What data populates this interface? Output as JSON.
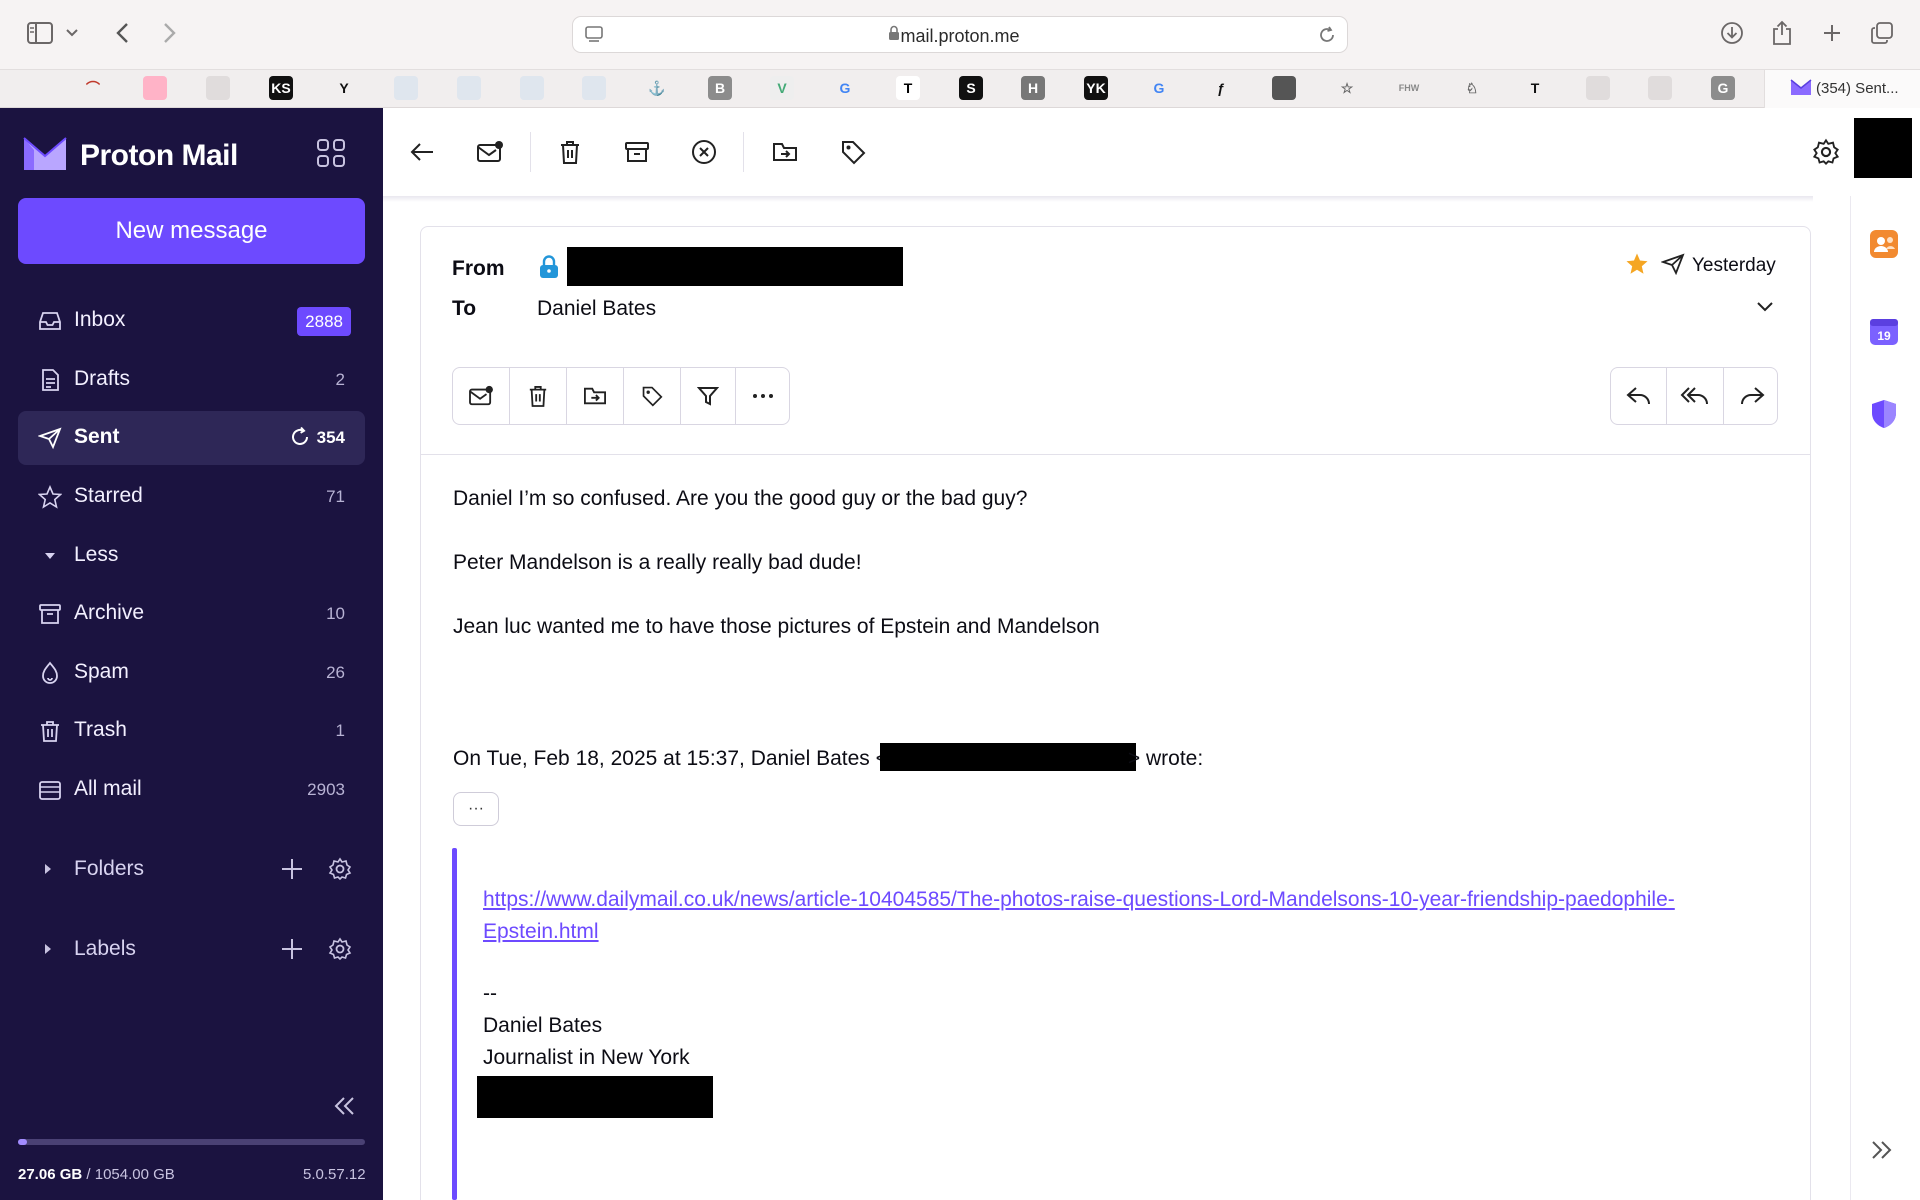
{
  "browser": {
    "url": "mail.proton.me",
    "active_tab_title": "(354) Sent...",
    "bookmarks": [
      {
        "icon": "apple-icon",
        "glyph": "",
        "color": "#8a8a8a",
        "bg": "transparent"
      },
      {
        "icon": "arch-icon",
        "glyph": "⌒",
        "color": "#c0392b",
        "bg": "transparent"
      },
      {
        "icon": "bag-icon",
        "glyph": "",
        "color": "#ff6f91",
        "bg": "#ffb3c7"
      },
      {
        "icon": "keyboard-icon",
        "glyph": "",
        "color": "#999",
        "bg": "#e0dcdc"
      },
      {
        "icon": "ks-icon",
        "glyph": "KS",
        "color": "#fff",
        "bg": "#111"
      },
      {
        "icon": "y-icon",
        "glyph": "Y",
        "color": "#111",
        "bg": "transparent"
      },
      {
        "icon": "page-icon",
        "glyph": "",
        "color": "#9ab",
        "bg": "#dfe6ee"
      },
      {
        "icon": "page-icon",
        "glyph": "",
        "color": "#9ab",
        "bg": "#dfe6ee"
      },
      {
        "icon": "page-icon",
        "glyph": "",
        "color": "#9ab",
        "bg": "#dfe6ee"
      },
      {
        "icon": "page-icon",
        "glyph": "",
        "color": "#9ab",
        "bg": "#dfe6ee"
      },
      {
        "icon": "anchor-icon",
        "glyph": "⚓",
        "color": "#222",
        "bg": "transparent"
      },
      {
        "icon": "b-icon",
        "glyph": "B",
        "color": "#fff",
        "bg": "#8c8c8c"
      },
      {
        "icon": "v-icon",
        "glyph": "V",
        "color": "#4a7",
        "bg": "#eee"
      },
      {
        "icon": "google-icon",
        "glyph": "G",
        "color": "#4285f4",
        "bg": "transparent"
      },
      {
        "icon": "t-icon",
        "glyph": "T",
        "color": "#000",
        "bg": "#fff"
      },
      {
        "icon": "s-icon",
        "glyph": "S",
        "color": "#fff",
        "bg": "#111"
      },
      {
        "icon": "h-icon",
        "glyph": "H",
        "color": "#fff",
        "bg": "#777"
      },
      {
        "icon": "yk-icon",
        "glyph": "YK",
        "color": "#fff",
        "bg": "#111"
      },
      {
        "icon": "google-icon",
        "glyph": "G",
        "color": "#4285f4",
        "bg": "transparent"
      },
      {
        "icon": "script-f-icon",
        "glyph": "ƒ",
        "color": "#111",
        "bg": "transparent"
      },
      {
        "icon": "photo-icon",
        "glyph": "",
        "color": "#444",
        "bg": "#555"
      },
      {
        "icon": "star-icon",
        "glyph": "☆",
        "color": "#666",
        "bg": "transparent"
      },
      {
        "icon": "fhw-icon",
        "glyph": "FHW",
        "color": "#888",
        "bg": "transparent"
      },
      {
        "icon": "wolf-icon",
        "glyph": "♘",
        "color": "#666",
        "bg": "transparent"
      },
      {
        "icon": "t-serif-icon",
        "glyph": "T",
        "color": "#111",
        "bg": "transparent"
      },
      {
        "icon": "keyboard-icon",
        "glyph": "",
        "color": "#999",
        "bg": "#e0dcdc"
      },
      {
        "icon": "keyboard-icon",
        "glyph": "",
        "color": "#999",
        "bg": "#e0dcdc"
      },
      {
        "icon": "g-grey-icon",
        "glyph": "G",
        "color": "#fff",
        "bg": "#8c8c8c"
      }
    ]
  },
  "sidebar": {
    "brand": "Proton Mail",
    "new_message_label": "New message",
    "items": [
      {
        "id": "inbox",
        "label": "Inbox",
        "count": "2888",
        "badge": true,
        "active": false,
        "icon": "inbox-icon"
      },
      {
        "id": "drafts",
        "label": "Drafts",
        "count": "2",
        "badge": false,
        "active": false,
        "icon": "drafts-icon"
      },
      {
        "id": "sent",
        "label": "Sent",
        "count": "354",
        "badge": false,
        "active": true,
        "icon": "sent-icon"
      },
      {
        "id": "starred",
        "label": "Starred",
        "count": "71",
        "badge": false,
        "active": false,
        "icon": "star-icon"
      },
      {
        "id": "less",
        "label": "Less",
        "count": "",
        "badge": false,
        "active": false,
        "icon": "caret-down-icon"
      },
      {
        "id": "archive",
        "label": "Archive",
        "count": "10",
        "badge": false,
        "active": false,
        "icon": "archive-icon"
      },
      {
        "id": "spam",
        "label": "Spam",
        "count": "26",
        "badge": false,
        "active": false,
        "icon": "spam-icon"
      },
      {
        "id": "trash",
        "label": "Trash",
        "count": "1",
        "badge": false,
        "active": false,
        "icon": "trash-icon"
      },
      {
        "id": "allmail",
        "label": "All mail",
        "count": "2903",
        "badge": false,
        "active": false,
        "icon": "allmail-icon"
      }
    ],
    "sections": [
      {
        "label": "Folders"
      },
      {
        "label": "Labels"
      }
    ],
    "storage_used": "27.06 GB",
    "storage_total": "/ 1054.00 GB",
    "storage_fraction": 0.026,
    "version": "5.0.57.12"
  },
  "message": {
    "from_label": "From",
    "to_label": "To",
    "to_name": "Daniel Bates",
    "date": "Yesterday",
    "body": [
      "Daniel I’m so confused. Are you the good guy or the bad guy?",
      "Peter Mandelson is a really really bad dude!",
      "Jean luc wanted me to have those pictures of Epstein and Mandelson"
    ],
    "quote_intro_before": "On Tue, Feb 18, 2025 at 15:37, Daniel Bates <",
    "quote_intro_after": "> wrote:",
    "ellipsis": "···",
    "quote_link": "https://www.dailymail.co.uk/news/article-10404585/The-photos-raise-questions-Lord-Mandelsons-10-year-friendship-paedophile-Epstein.html",
    "signature": [
      "--",
      "Daniel Bates",
      "Journalist in New York"
    ]
  },
  "colors": {
    "sidebar_bg": "#1b1340",
    "accent": "#6d4aff",
    "star": "#f5a623"
  }
}
